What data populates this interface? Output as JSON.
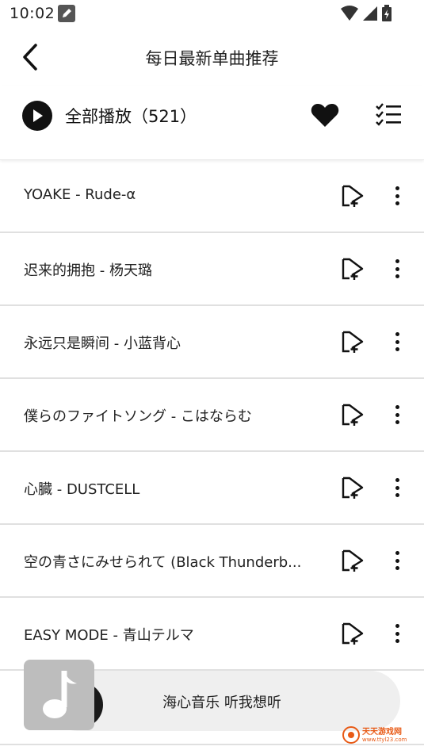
{
  "status_bar": {
    "time": "10:02",
    "icons": [
      "edit-notification-icon",
      "wifi-icon",
      "signal-icon",
      "battery-icon"
    ]
  },
  "header": {
    "title": "每日最新单曲推荐",
    "back_icon": "chevron-left-icon"
  },
  "play_all": {
    "label": "全部播放（521）",
    "icons": [
      "play-circle-icon",
      "heart-icon",
      "list-check-icon"
    ]
  },
  "songs": [
    {
      "title": "YOAKE - Rude-α"
    },
    {
      "title": "迟来的拥抱 - 杨天璐"
    },
    {
      "title": "永远只是瞬间 - 小蓝背心"
    },
    {
      "title": "僕らのファイトソング - こはならむ"
    },
    {
      "title": "心臓 - DUSTCELL"
    },
    {
      "title": "空の青さにみせられて (Black Thunderb..."
    },
    {
      "title": "EASY MODE - 青山テルマ"
    }
  ],
  "song_row_icons": [
    "add-to-playlist-icon",
    "more-vertical-icon"
  ],
  "mini_player": {
    "text": "海心音乐 听我想听",
    "cover_icon": "music-note-icon"
  },
  "watermark": {
    "main": "天天游戏网",
    "sub": "www.ttyl23.com"
  },
  "colors": {
    "background": "#ffffff",
    "text": "#222222",
    "divider": "#e0e0e0",
    "mini_player_bg": "#efefef",
    "watermark": "#e85a16"
  }
}
